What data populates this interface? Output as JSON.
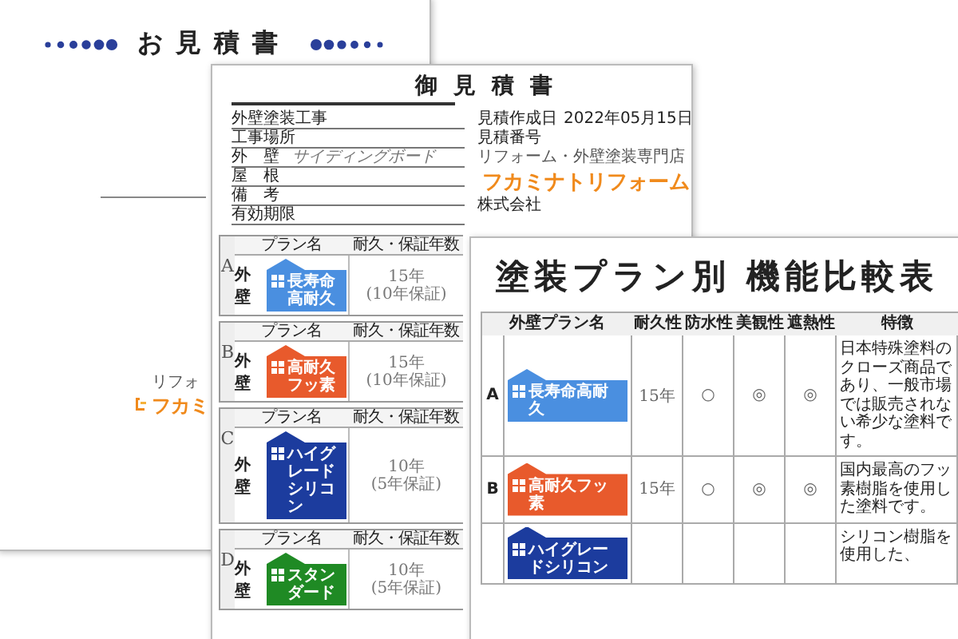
{
  "back_sheet": {
    "title": "お見積書",
    "logo": {
      "tagline": "リフォ",
      "name": "フカミ"
    }
  },
  "estimate_sheet": {
    "title": "御見積書",
    "fields": [
      {
        "label": "外壁塗装工事"
      },
      {
        "label": "工事場所"
      },
      {
        "label": "外　壁",
        "value": "サイディングボード"
      },
      {
        "label": "屋　根"
      },
      {
        "label": "備　考"
      },
      {
        "label": "有効期限"
      }
    ],
    "issue_label": "見積作成日",
    "issue_date": "2022年05月15日",
    "number_label": "見積番号",
    "logo": {
      "tagline": "リフォーム・外壁塗装専門店",
      "name": "フカミナトリフォーム"
    },
    "company": "株式会社",
    "plans": [
      {
        "letter": "A",
        "plan_header": "プラン名",
        "years_header": "耐久・保証年数",
        "wall": "外壁",
        "name": "長寿命高耐久",
        "color": "#4a8fe0",
        "durability": "15年",
        "warranty": "(10年保証)"
      },
      {
        "letter": "B",
        "plan_header": "プラン名",
        "years_header": "耐久・保証年数",
        "wall": "外壁",
        "name": "高耐久フッ素",
        "color": "#e85a2c",
        "durability": "15年",
        "warranty": "(10年保証)"
      },
      {
        "letter": "C",
        "plan_header": "プラン名",
        "years_header": "耐久・保証年数",
        "wall": "外壁",
        "name": "ハイグレードシリコン",
        "color": "#1c3c9e",
        "durability": "10年",
        "warranty": "(5年保証)"
      },
      {
        "letter": "D",
        "plan_header": "プラン名",
        "years_header": "耐久・保証年数",
        "wall": "外壁",
        "name": "スタンダード",
        "color": "#1f8a24",
        "durability": "10年",
        "warranty": "(5年保証)"
      }
    ]
  },
  "comparison_sheet": {
    "title": "塗装プラン別 機能比較表",
    "columns": [
      "外壁プラン名",
      "耐久性",
      "防水性",
      "美観性",
      "遮熱性",
      "特徴"
    ],
    "rows": [
      {
        "letter": "A",
        "name": "長寿命高耐久",
        "color": "#4a8fe0",
        "durability": "15年",
        "waterproof": "○",
        "appearance": "◎",
        "heat_shield": "◎",
        "feature": "日本特殊塗料のクローズ商品であり、一般市場では販売されない希少な塗料です。"
      },
      {
        "letter": "B",
        "name": "高耐久フッ素",
        "color": "#e85a2c",
        "durability": "15年",
        "waterproof": "○",
        "appearance": "◎",
        "heat_shield": "◎",
        "feature": "国内最高のフッ素樹脂を使用した塗料です。"
      },
      {
        "name": "ハイグレードシリコン",
        "color": "#1c3c9e",
        "feature": "シリコン樹脂を使用した、"
      }
    ]
  }
}
